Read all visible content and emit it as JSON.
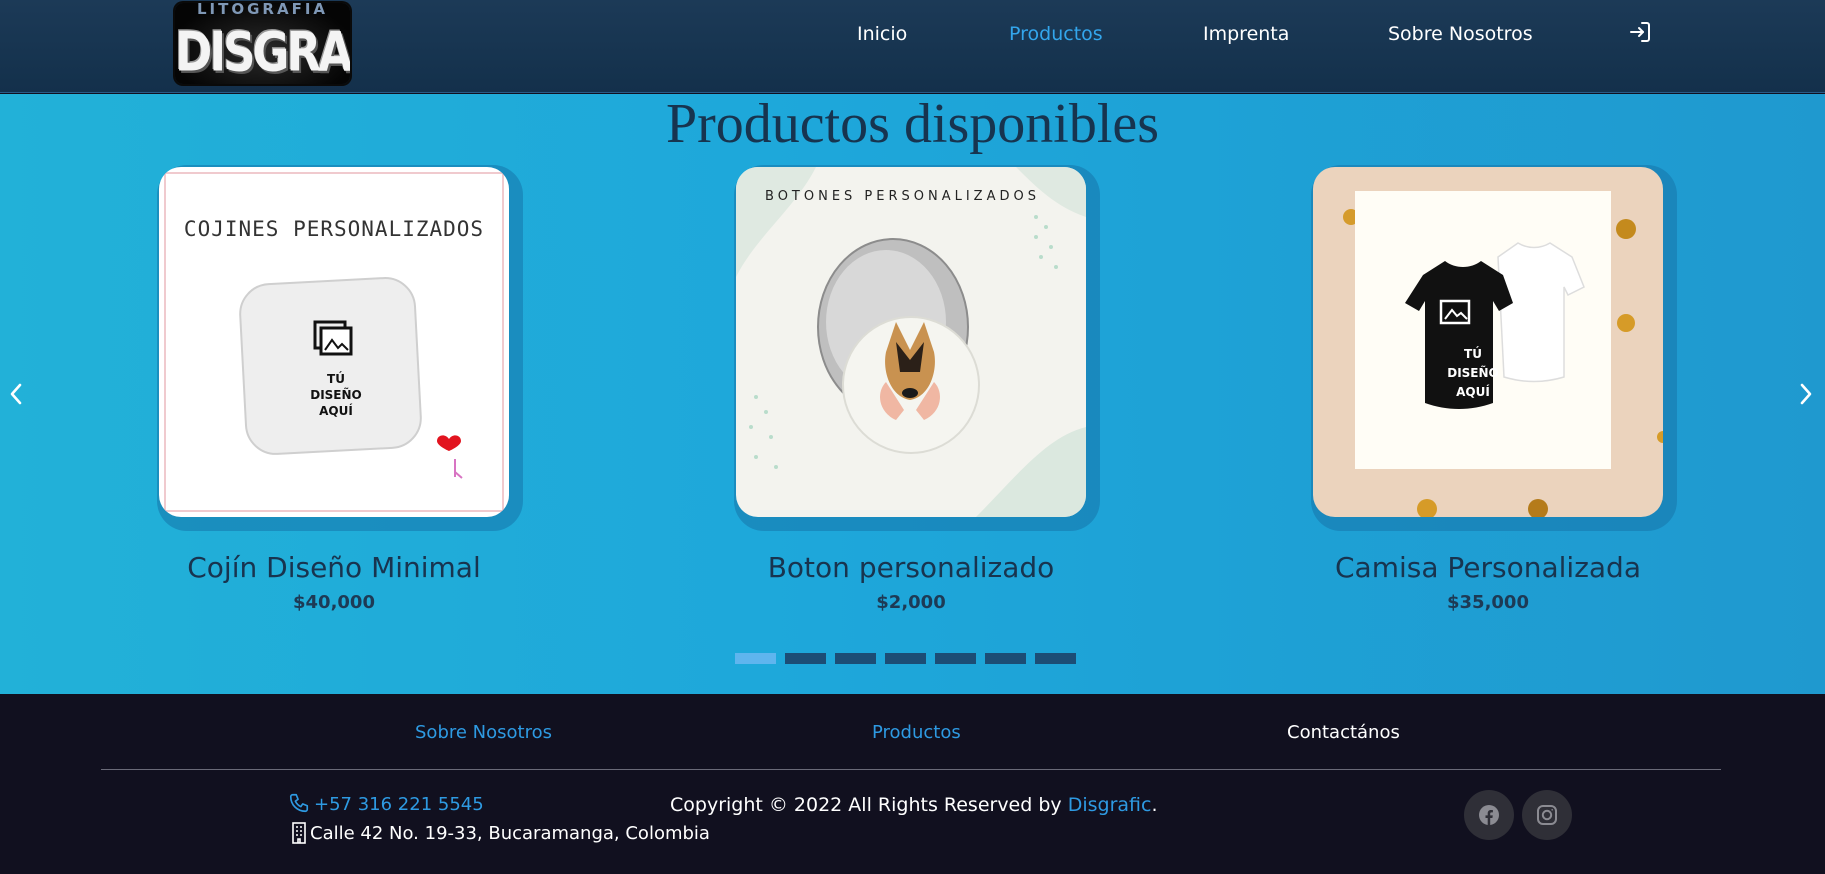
{
  "header": {
    "logo": {
      "top_text": "LITOGRAFIA",
      "main_text": "DISGRAFIC"
    },
    "nav": [
      {
        "label": "Inicio",
        "active": false
      },
      {
        "label": "Productos",
        "active": true
      },
      {
        "label": "Imprenta",
        "active": false
      },
      {
        "label": "Sobre Nosotros",
        "active": false
      }
    ],
    "login_icon": "login-icon"
  },
  "main": {
    "title": "Productos disponibles",
    "products": [
      {
        "name": "Cojín Diseño Minimal",
        "price": "$40,000",
        "image": {
          "heading": "COJINES PERSONALIZADOS",
          "caption": [
            "TÚ",
            "DISEÑO",
            "AQUÍ"
          ]
        }
      },
      {
        "name": "Boton personalizado",
        "price": "$2,000",
        "image": {
          "heading": "BOTONES PERSONALIZADOS"
        }
      },
      {
        "name": "Camisa Personalizada",
        "price": "$35,000",
        "image": {
          "caption": [
            "TÚ",
            "DISEÑO",
            "AQUÍ"
          ]
        }
      }
    ],
    "carousel": {
      "prev_icon": "chevron-left-icon",
      "next_icon": "chevron-right-icon",
      "slides": 7,
      "active_slide": 1
    }
  },
  "footer": {
    "links": [
      {
        "label": "Sobre Nosotros"
      },
      {
        "label": "Productos"
      },
      {
        "label": "Contactános"
      }
    ],
    "phone": "+57 316 221 5545",
    "address": "Calle 42 No. 19-33, Bucaramanga, Colombia",
    "copyright_prefix": "Copyright © 2022 All Rights Reserved by ",
    "brand": "Disgrafic",
    "copyright_suffix": ".",
    "social": [
      "facebook-icon",
      "instagram-icon"
    ]
  },
  "colors": {
    "nav_bg": "#163552",
    "accent": "#33a6ec",
    "main_bg": "#1fa6da",
    "title": "#17344f",
    "footer_bg": "#11101f",
    "dot_active": "#5fb5ee",
    "dot_inactive": "#1c4d75"
  }
}
